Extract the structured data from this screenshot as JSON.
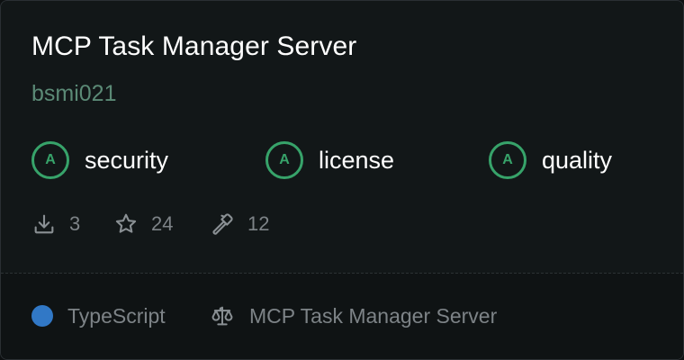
{
  "server": {
    "title": "MCP Task Manager Server",
    "author": "bsmi021"
  },
  "badges": [
    {
      "grade": "A",
      "label": "security"
    },
    {
      "grade": "A",
      "label": "license"
    },
    {
      "grade": "A",
      "label": "quality"
    }
  ],
  "stats": {
    "downloads": "3",
    "stars": "24",
    "tools": "12",
    "downloads_icon": "download-icon",
    "stars_icon": "star-icon",
    "tools_icon": "hammer-icon"
  },
  "footer": {
    "language": "TypeScript",
    "language_color": "#3178c6",
    "license_icon": "scale-icon",
    "license_name": "MCP Task Manager Server"
  },
  "colors": {
    "grade_green": "#37a36a",
    "author_green": "#5b8a76"
  }
}
